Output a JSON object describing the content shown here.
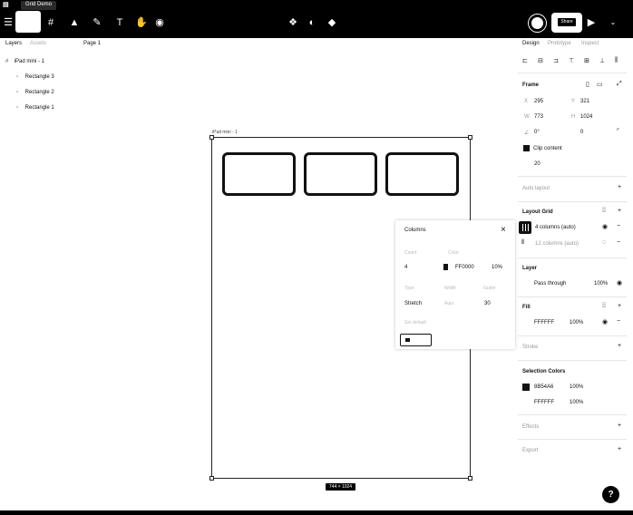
{
  "topbar": {
    "file_name": "Grid Demo",
    "zoom_label": "Share"
  },
  "left_panel": {
    "tabs": [
      "Layers",
      "Assets"
    ],
    "page": "Page 1",
    "layers": [
      "iPad mini - 1",
      "Rectangle 3",
      "Rectangle 2",
      "Rectangle 1"
    ]
  },
  "canvas": {
    "board_label": "iPad mini - 1",
    "size_badge": "744 × 1024"
  },
  "column_popup": {
    "title": "Columns",
    "count_label": "Count",
    "color_label": "Color",
    "count": "4",
    "color": "FF0000",
    "opacity": "10%",
    "type_label": "Type",
    "width_label": "Width",
    "gutter_label": "Gutter",
    "type": "Stretch",
    "width": "Auto",
    "gutter": "30",
    "set_default_label": "Set default"
  },
  "right_panel": {
    "tabs": [
      "Design",
      "Prototype",
      "Inspect"
    ],
    "frame_title": "Frame",
    "x": "295",
    "y": "321",
    "w": "773",
    "h": "1024",
    "rotation": "0°",
    "radius": "0",
    "clip_content": "Clip content",
    "clip_value": "20",
    "auto_layout": "Auto layout",
    "layout_grid_title": "Layout Grid",
    "grid_1": "4 columns (auto)",
    "grid_2": "12 columns (auto)",
    "layer_title": "Layer",
    "blend": "Pass through",
    "blend_opacity": "100%",
    "fill_title": "Fill",
    "fill_color": "FFFFFF",
    "fill_opacity": "100%",
    "stroke_title": "Stroke",
    "selection_colors_title": "Selection Colors",
    "sel_color_1": "8B54A6",
    "sel_opacity_1": "100%",
    "sel_color_2": "FFFFFF",
    "sel_opacity_2": "100%",
    "effects_title": "Effects",
    "export_title": "Export"
  },
  "help_label": "?",
  "colors": {
    "chrome": "#000000",
    "background": "#ffffff",
    "stroke": "#111111"
  }
}
